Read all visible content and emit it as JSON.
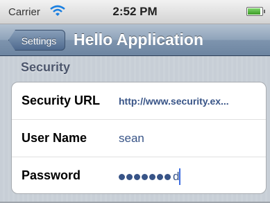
{
  "status_bar": {
    "carrier": "Carrier",
    "time": "2:52 PM",
    "battery_level": 1.0
  },
  "nav_bar": {
    "back_label": "Settings",
    "title": "Hello Application"
  },
  "section": {
    "header": "Security"
  },
  "rows": [
    {
      "label": "Security URL",
      "value": "http://www.security.ex..."
    },
    {
      "label": "User Name",
      "value": "sean"
    },
    {
      "label": "Password",
      "masked_count": 7,
      "last_char": "d"
    }
  ],
  "colors": {
    "nav_bar": "#7e94ae",
    "value_text": "#385487",
    "section_header": "#4c566c",
    "caret": "#3d6de0"
  }
}
